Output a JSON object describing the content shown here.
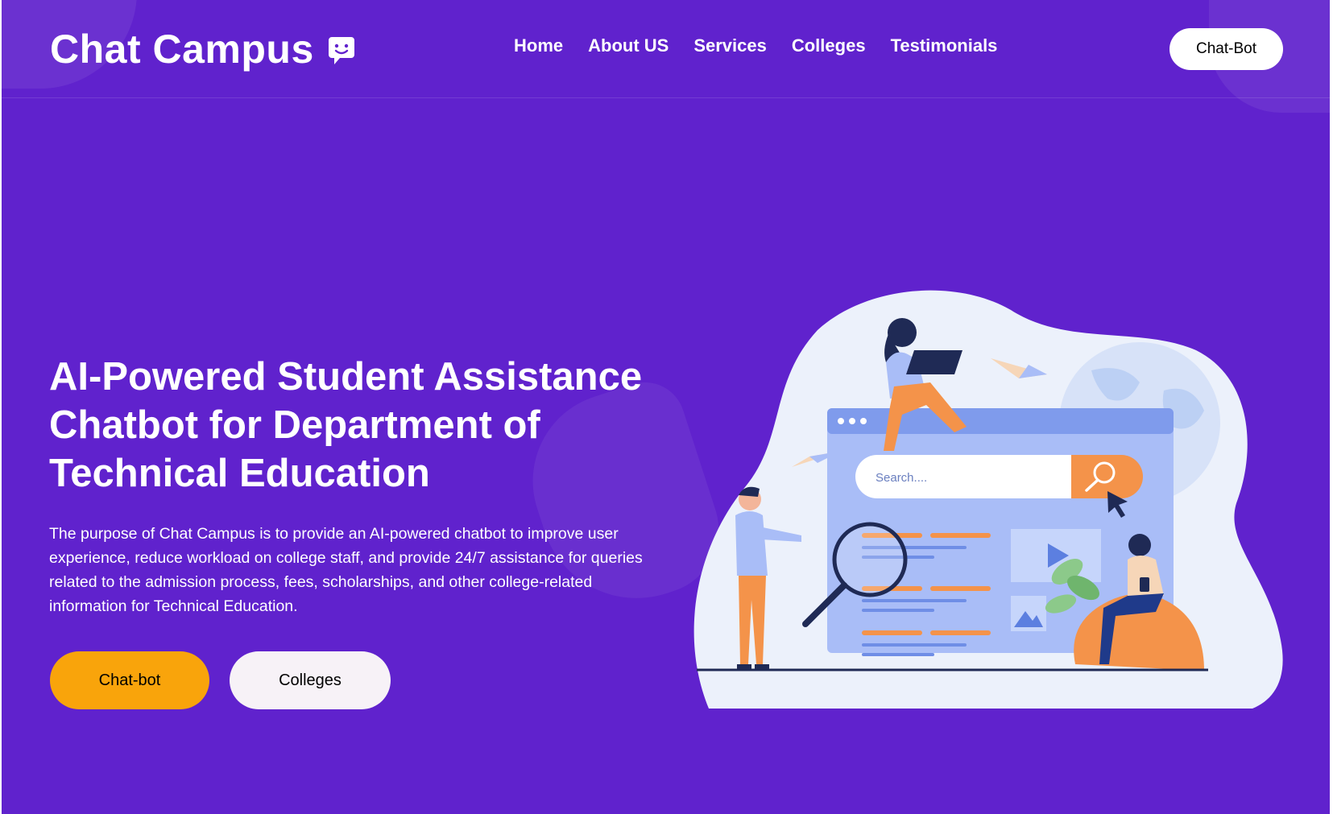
{
  "brand": {
    "name": "Chat Campus",
    "icon": "chat-smile-icon"
  },
  "nav": {
    "items": [
      "Home",
      "About US",
      "Services",
      "Colleges",
      "Testimonials"
    ]
  },
  "header": {
    "cta_label": "Chat-Bot"
  },
  "hero": {
    "title": "AI-Powered Student Assistance Chatbot for Department of Technical Education",
    "description": "The purpose of Chat Campus is to provide an AI-powered chatbot to improve user experience, reduce workload on college staff, and provide 24/7 assistance for queries related to the admission process, fees, scholarships, and other college-related information for Technical Education.",
    "primary_button": "Chat-bot",
    "secondary_button": "Colleges"
  },
  "illustration": {
    "search_placeholder": "Search...."
  },
  "colors": {
    "background": "#6022cd",
    "primary_button": "#f9a40b",
    "secondary_button": "#f7f2f7",
    "illustration_orange": "#f4934a",
    "illustration_blue": "#a9bdf7"
  }
}
